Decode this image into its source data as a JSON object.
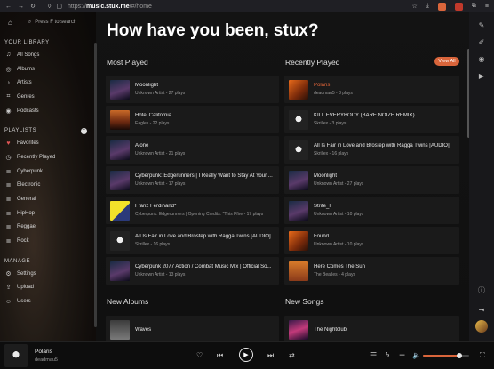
{
  "browser": {
    "url_prefix": "https://",
    "url_host": "music.stux.me",
    "url_path": "/#/home"
  },
  "sidebar": {
    "search_placeholder": "Press F to search",
    "library_heading": "YOUR LIBRARY",
    "library_items": [
      {
        "label": "All Songs",
        "icon": "music-note-icon"
      },
      {
        "label": "Albums",
        "icon": "disc-icon"
      },
      {
        "label": "Artists",
        "icon": "microphone-icon"
      },
      {
        "label": "Genres",
        "icon": "tag-icon"
      },
      {
        "label": "Podcasts",
        "icon": "podcast-icon"
      }
    ],
    "playlists_heading": "PLAYLISTS",
    "playlist_items": [
      {
        "label": "Favorites",
        "icon": "heart-icon"
      },
      {
        "label": "Recently Played",
        "icon": "clock-icon"
      },
      {
        "label": "Cyberpunk",
        "icon": "list-icon"
      },
      {
        "label": "Electronic",
        "icon": "list-icon"
      },
      {
        "label": "General",
        "icon": "list-icon"
      },
      {
        "label": "HipHop",
        "icon": "list-icon"
      },
      {
        "label": "Reggae",
        "icon": "list-icon"
      },
      {
        "label": "Rock",
        "icon": "list-icon"
      }
    ],
    "manage_heading": "MANAGE",
    "manage_items": [
      {
        "label": "Settings",
        "icon": "gear-icon"
      },
      {
        "label": "Upload",
        "icon": "upload-icon"
      },
      {
        "label": "Users",
        "icon": "users-icon"
      }
    ]
  },
  "main": {
    "greeting": "How have you been, stux?",
    "most_played_heading": "Most Played",
    "recently_played_heading": "Recently Played",
    "view_all_label": "View All",
    "new_albums_heading": "New Albums",
    "new_songs_heading": "New Songs",
    "most_played": [
      {
        "title": "Moonlight",
        "sub": "Unknown Artist - 27 plays",
        "art": "t-night"
      },
      {
        "title": "Hotel California",
        "sub": "Eagles - 22 plays",
        "art": "t-hotel"
      },
      {
        "title": "Alone",
        "sub": "Unknown Artist - 21 plays",
        "art": "t-night"
      },
      {
        "title": "Cyberpunk: Edgerunners | I Really Want to Stay At Your ...",
        "sub": "Unknown Artist - 17 plays",
        "art": "t-night"
      },
      {
        "title": "Franz Ferdinand*",
        "sub": "Cyberpunk: Edgerunners | Opening Credits: \"This Ffire - 17 plays",
        "art": "t-yellow"
      },
      {
        "title": "All Is Fair in Love and Brostep with Ragga Twins [AUDIO]",
        "sub": "Skrillex - 16 plays",
        "art": "t-skull"
      },
      {
        "title": "Cyberpunk 2077 Action / Combat Music Mix | Official So...",
        "sub": "Unknown Artist - 13 plays",
        "art": "t-night"
      }
    ],
    "recently_played": [
      {
        "title": "Polaris",
        "sub": "deadmau5 - 8 plays",
        "art": "t-fire",
        "active": true
      },
      {
        "title": "KILL EVERYBODY (BARE NOIZE REMIX)",
        "sub": "Skrillex - 3 plays",
        "art": "t-skull"
      },
      {
        "title": "All Is Fair in Love and Brostep with Ragga Twins [AUDIO]",
        "sub": "Skrillex - 16 plays",
        "art": "t-skull"
      },
      {
        "title": "Moonlight",
        "sub": "Unknown Artist - 27 plays",
        "art": "t-night"
      },
      {
        "title": "Strife_I",
        "sub": "Unknown Artist - 10 plays",
        "art": "t-night"
      },
      {
        "title": "Found",
        "sub": "Unknown Artist - 10 plays",
        "art": "t-fire"
      },
      {
        "title": "Here Comes The Sun",
        "sub": "The Beatles - 4 plays",
        "art": "t-beatles"
      }
    ],
    "new_albums": [
      {
        "title": "Waves",
        "art": "t-waves"
      }
    ],
    "new_songs": [
      {
        "title": "The Nightclub",
        "art": "t-club"
      }
    ]
  },
  "player": {
    "title": "Polaris",
    "artist": "deadmau5",
    "volume_fraction": 0.78
  },
  "colors": {
    "accent": "#d9653b"
  }
}
